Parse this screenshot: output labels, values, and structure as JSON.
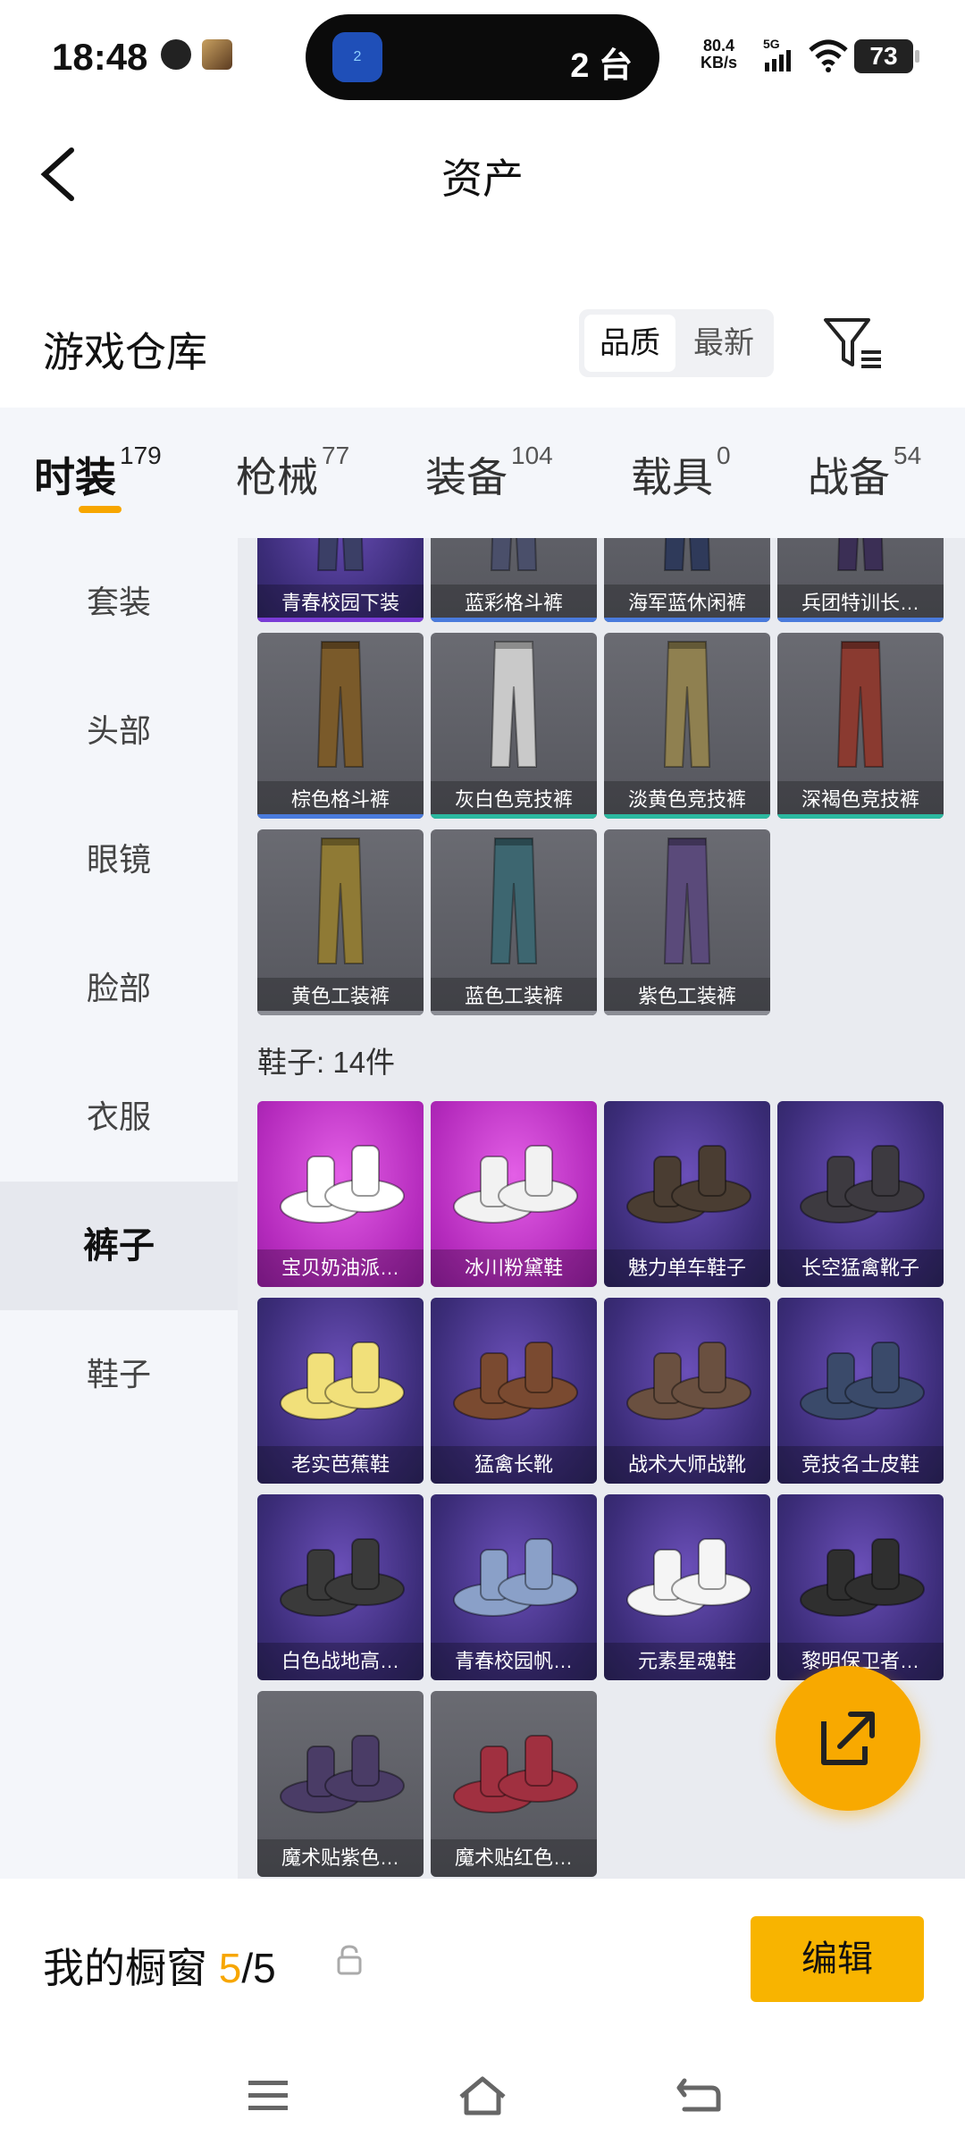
{
  "status_bar": {
    "time": "18:48",
    "island_count": "2 台",
    "island_app_badge": "2",
    "net_speed": "80.4",
    "net_unit": "KB/s",
    "network": "5G",
    "battery": "73"
  },
  "header": {
    "title": "资产",
    "back_icon": "chevron-left-icon"
  },
  "warehouse": {
    "title": "游戏仓库",
    "sort_options": [
      "品质",
      "最新"
    ],
    "selected_sort": "品质",
    "filter_icon": "filter-icon"
  },
  "tabs": [
    {
      "label": "时装",
      "count": "179",
      "active": true
    },
    {
      "label": "枪械",
      "count": "77"
    },
    {
      "label": "装备",
      "count": "104"
    },
    {
      "label": "载具",
      "count": "0"
    },
    {
      "label": "战备",
      "count": "54"
    }
  ],
  "sidebar": {
    "items": [
      "套装",
      "头部",
      "眼镜",
      "脸部",
      "衣服",
      "裤子",
      "鞋子"
    ],
    "active": "裤子"
  },
  "pants_items": [
    {
      "label": "青春校园下装",
      "bg": "purple",
      "bar": "#7a3cd6"
    },
    {
      "label": "蓝彩格斗裤",
      "bg": "gray",
      "bar": "#4a7bdc"
    },
    {
      "label": "海军蓝休闲裤",
      "bg": "gray",
      "bar": "#4a7bdc"
    },
    {
      "label": "兵团特训长…",
      "bg": "gray",
      "bar": "#4a7bdc"
    },
    {
      "label": "棕色格斗裤",
      "bg": "gray",
      "bar": "#4a7bdc"
    },
    {
      "label": "灰白色竞技裤",
      "bg": "gray",
      "bar": "#2bb9a0"
    },
    {
      "label": "淡黄色竞技裤",
      "bg": "gray",
      "bar": "#2bb9a0"
    },
    {
      "label": "深褐色竞技裤",
      "bg": "gray",
      "bar": "#2bb9a0"
    },
    {
      "label": "黄色工装裤",
      "bg": "gray",
      "bar": "#8b8d95"
    },
    {
      "label": "蓝色工装裤",
      "bg": "gray",
      "bar": "#8b8d95"
    },
    {
      "label": "紫色工装裤",
      "bg": "gray",
      "bar": "#8b8d95"
    }
  ],
  "shoes_section": {
    "label": "鞋子: 14件"
  },
  "shoes_items": [
    {
      "label": "宝贝奶油派…",
      "bg": "pink"
    },
    {
      "label": "冰川粉黛鞋",
      "bg": "pink"
    },
    {
      "label": "魅力单车鞋子",
      "bg": "purple"
    },
    {
      "label": "长空猛禽靴子",
      "bg": "purple"
    },
    {
      "label": "老实芭蕉鞋",
      "bg": "purple"
    },
    {
      "label": "猛禽长靴",
      "bg": "purple"
    },
    {
      "label": "战术大师战靴",
      "bg": "purple"
    },
    {
      "label": "竞技名士皮鞋",
      "bg": "purple"
    },
    {
      "label": "白色战地高…",
      "bg": "purple"
    },
    {
      "label": "青春校园帆…",
      "bg": "purple"
    },
    {
      "label": "元素星魂鞋",
      "bg": "purple"
    },
    {
      "label": "黎明保卫者…",
      "bg": "purple"
    },
    {
      "label": "魔术贴紫色…",
      "bg": "gray"
    },
    {
      "label": "魔术贴红色…",
      "bg": "gray"
    }
  ],
  "showcase": {
    "label": "我的橱窗",
    "current": "5",
    "separator": "/",
    "total": "5",
    "edit_label": "编辑"
  },
  "fab_icon": "share-external-icon"
}
